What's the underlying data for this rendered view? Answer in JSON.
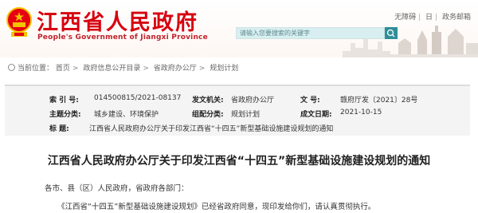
{
  "header": {
    "site_title": "江西省人民政府",
    "site_subtitle": "People's Government of Jiangxi Province",
    "top_links": [
      "无障碍",
      "日",
      "政务邮箱"
    ],
    "search_placeholder": "请输入您要搜索的关键字"
  },
  "breadcrumb": {
    "label": "当前位置：",
    "items": [
      "首页",
      "政府信息公开目录",
      "省政府办公厅",
      "规划计划"
    ]
  },
  "info": {
    "index_label": "索  引  号:",
    "index_value": "014500815/2021-08137",
    "issuer_label": "发文机关:",
    "issuer_value": "省政府办公厅",
    "docno_label": "文        号:",
    "docno_value": "赣府厅发〔2021〕28号",
    "theme_label": "主题分类:",
    "theme_value": "城乡建设、环境保护",
    "genre_label": "组配分类:",
    "genre_value": "规划计划",
    "date_label": "成文日期:",
    "date_value": "2021-10-15",
    "title_label": "标        题:",
    "title_value": "江西省人民政府办公厅关于印发江西省“十四五”新型基础设施建设规划的通知"
  },
  "article": {
    "title": "江西省人民政府办公厅关于印发江西省“十四五”新型基础设施建设规划的通知",
    "salutation": "各市、县（区）人民政府，省政府各部门：",
    "body_line1": "《江西省“十四五”新型基础设施建设规划》已经省政府同意，现印发给你们，请认真贯彻执行。"
  },
  "colors": {
    "brand_red": "#d7000f",
    "search_teal": "#2f8e97"
  }
}
